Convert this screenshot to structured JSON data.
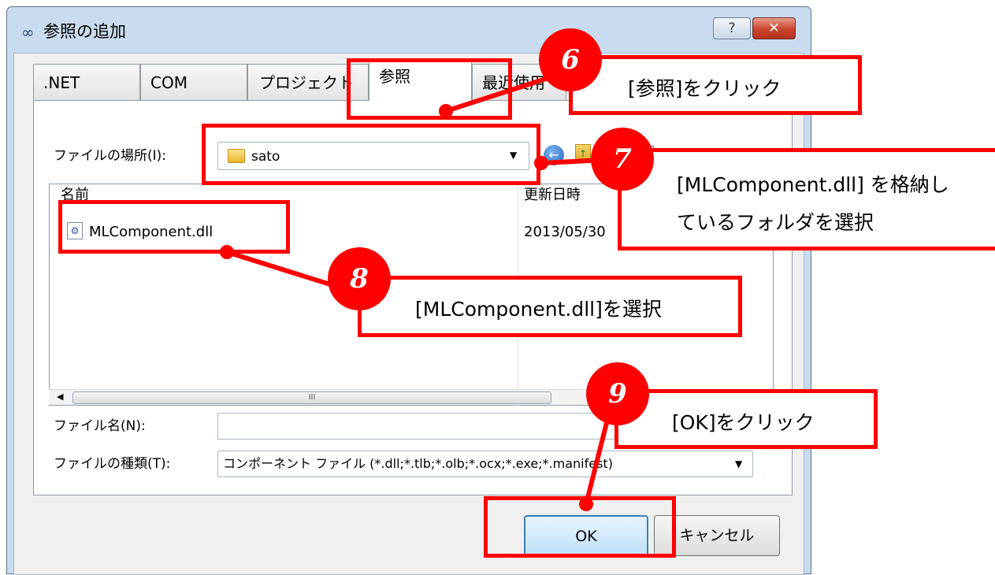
{
  "window": {
    "title": "参照の追加",
    "title_icon": "∞",
    "help_label": "?",
    "close_label": "✕"
  },
  "tabs": [
    {
      "label": ".NET"
    },
    {
      "label": "COM"
    },
    {
      "label": "プロジェクト"
    },
    {
      "label": "参照",
      "active": true
    },
    {
      "label": "最近使用"
    }
  ],
  "location": {
    "label": "ファイルの場所(I):",
    "value": "sato"
  },
  "file_list": {
    "columns": [
      "名前",
      "更新日時"
    ],
    "rows": [
      {
        "name": "MLComponent.dll",
        "modified": "2013/05/30"
      }
    ]
  },
  "scrollbar": {
    "thumb_grip": "III"
  },
  "filename": {
    "label": "ファイル名(N):",
    "value": ""
  },
  "filetype": {
    "label": "ファイルの種類(T):",
    "value": "コンポーネント ファイル (*.dll;*.tlb;*.olb;*.ocx;*.exe;*.manifest)"
  },
  "buttons": {
    "ok": "OK",
    "cancel": "キャンセル"
  },
  "annotations": {
    "step6": {
      "number": "6",
      "text": "[参照]をクリック"
    },
    "step7": {
      "number": "7",
      "text_line1": "[MLComponent.dll] を格納し",
      "text_line2": "ているフォルダを選択"
    },
    "step8": {
      "number": "8",
      "text": "[MLComponent.dll]を選択"
    },
    "step9": {
      "number": "9",
      "text": "[OK]をクリック"
    }
  },
  "colors": {
    "annotation_red": "#ff0000",
    "window_frame": "#c9dbee",
    "dialog_bg": "#f0f0f0"
  }
}
